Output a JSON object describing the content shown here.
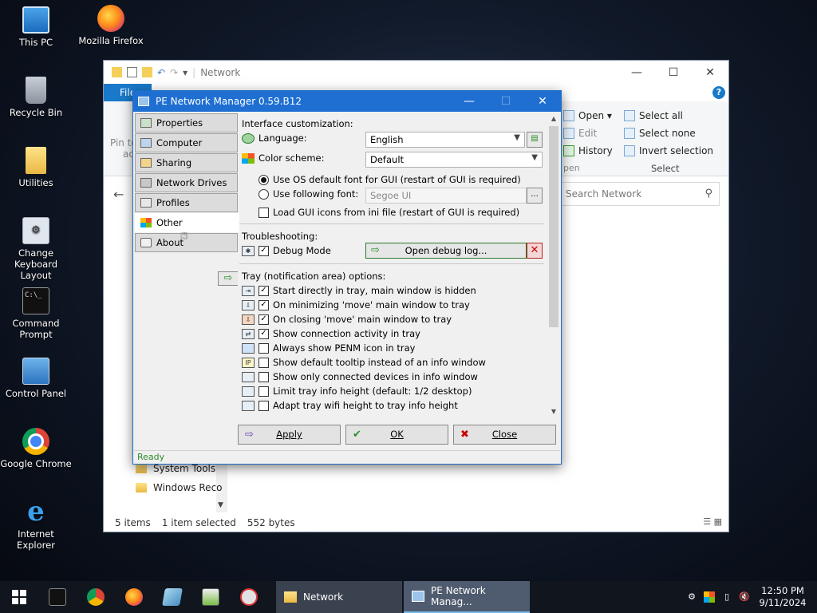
{
  "desktop": {
    "icons": [
      {
        "label": "This PC",
        "icon": "this-pc-icon"
      },
      {
        "label": "Mozilla Firefox",
        "icon": "firefox-icon"
      },
      {
        "label": "Recycle Bin",
        "icon": "recycle-bin-icon"
      },
      {
        "label": "Utilities",
        "icon": "folder-icon"
      },
      {
        "label": "Change Keyboard Layout",
        "icon": "keyboard-icon"
      },
      {
        "label": "Command Prompt",
        "icon": "cmd-icon"
      },
      {
        "label": "Control Panel",
        "icon": "control-panel-icon"
      },
      {
        "label": "Google Chrome",
        "icon": "chrome-icon"
      },
      {
        "label": "Internet Explorer",
        "icon": "ie-icon"
      }
    ]
  },
  "explorer": {
    "title": "Network",
    "file_tab": "File",
    "ribbon": {
      "pin_to": "Pin to",
      "pin_to_2": "acc",
      "open": "Open ▾",
      "edit": "Edit",
      "history": "History",
      "open_group": "pen",
      "select_all": "Select all",
      "select_none": "Select none",
      "invert_selection": "Invert selection",
      "select_group": "Select"
    },
    "search_placeholder": "Search Network",
    "nav_items": [
      "System Tools",
      "Windows Reco"
    ],
    "status": {
      "items": "5 items",
      "selected": "1 item selected",
      "size": "552 bytes"
    }
  },
  "penm": {
    "title": "PE Network Manager 0.59.B12",
    "tabs": [
      "Properties",
      "Computer",
      "Sharing",
      "Network Drives",
      "Profiles",
      "Other",
      "About"
    ],
    "active_tab": "Other",
    "interface_section": "Interface customization:",
    "language_label": "Language:",
    "language_value": "English",
    "color_scheme_label": "Color scheme:",
    "color_scheme_value": "Default",
    "radio_os_font": "Use OS default font for GUI (restart of GUI is required)",
    "radio_following_font": "Use following font:",
    "font_value": "Segoe UI",
    "browse_label": "...",
    "load_icons": "Load GUI icons from ini file (restart of GUI is required)",
    "troubleshooting_section": "Troubleshooting:",
    "debug_mode": "Debug Mode",
    "open_debug_log": "Open debug log...",
    "tray_section": "Tray (notification area) options:",
    "tray_options": [
      {
        "label": "Start directly in tray, main window is hidden",
        "checked": true
      },
      {
        "label": "On minimizing 'move' main window to tray",
        "checked": true
      },
      {
        "label": "On closing 'move' main window to tray",
        "checked": true
      },
      {
        "label": "Show connection activity in tray",
        "checked": true
      },
      {
        "label": "Always show PENM icon in tray",
        "checked": false
      },
      {
        "label": "Show default tooltip instead of an info window",
        "checked": false
      },
      {
        "label": "Show only connected devices in info window",
        "checked": false
      },
      {
        "label": "Limit tray info height (default: 1/2 desktop)",
        "checked": false
      },
      {
        "label": "Adapt tray wifi height to tray info height",
        "checked": false
      }
    ],
    "apply": "Apply",
    "ok": "OK",
    "close": "Close",
    "status": "Ready"
  },
  "taskbar": {
    "tasks": [
      {
        "label": "Network",
        "icon": "folder-icon"
      },
      {
        "label": "PE Network Manag...",
        "icon": "penm-icon"
      }
    ],
    "clock_time": "12:50 PM",
    "clock_date": "9/11/2024"
  }
}
